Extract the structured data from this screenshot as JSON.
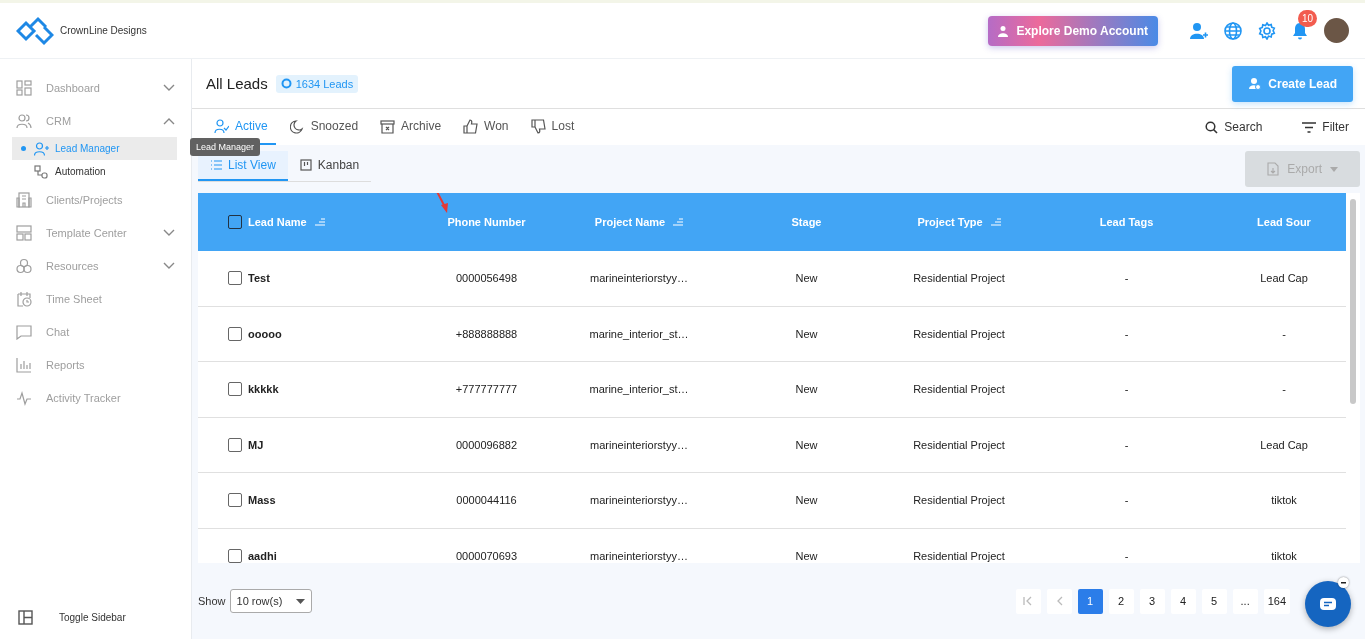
{
  "header": {
    "brand": "CrownLine Designs",
    "demo_button": "Explore Demo Account",
    "notification_count": "10"
  },
  "sidebar": {
    "items": [
      {
        "label": "Dashboard",
        "selected": false,
        "expanded": false
      },
      {
        "label": "CRM",
        "selected": false,
        "expanded": true,
        "children": [
          {
            "label": "Lead Manager",
            "selected": true
          },
          {
            "label": "Automation",
            "selected": false
          }
        ]
      },
      {
        "label": "Clients/Projects",
        "selected": false
      },
      {
        "label": "Template Center",
        "selected": false,
        "expanded": false
      },
      {
        "label": "Resources",
        "selected": false,
        "expanded": false
      },
      {
        "label": "Time Sheet",
        "selected": false
      },
      {
        "label": "Chat",
        "selected": false
      },
      {
        "label": "Reports",
        "selected": false
      },
      {
        "label": "Activity Tracker",
        "selected": false
      }
    ],
    "toggle": "Toggle Sidebar",
    "tooltip": "Lead Manager"
  },
  "page": {
    "title": "All Leads",
    "count_badge": "1634 Leads",
    "create_button": "Create Lead"
  },
  "status_tabs": [
    {
      "label": "Active",
      "selected": true
    },
    {
      "label": "Snoozed",
      "selected": false
    },
    {
      "label": "Archive",
      "selected": false
    },
    {
      "label": "Won",
      "selected": false
    },
    {
      "label": "Lost",
      "selected": false
    }
  ],
  "toolbar": {
    "search": "Search",
    "filter": "Filter"
  },
  "view_tabs": [
    {
      "label": "List View",
      "selected": true
    },
    {
      "label": "Kanban",
      "selected": false
    }
  ],
  "export": {
    "label": "Export",
    "disabled": true
  },
  "table": {
    "all_checked": false,
    "columns": [
      {
        "label": "Lead Name",
        "sortable": true
      },
      {
        "label": "Phone Number",
        "sortable": false
      },
      {
        "label": "Project Name",
        "sortable": true
      },
      {
        "label": "Stage",
        "sortable": false
      },
      {
        "label": "Project Type",
        "sortable": true
      },
      {
        "label": "Lead Tags",
        "sortable": false
      },
      {
        "label": "Lead Sour",
        "sortable": false
      }
    ],
    "rows": [
      {
        "checked": false,
        "cells": [
          "Test",
          "0000056498",
          "marineinteriorstyy…",
          "New",
          "Residential Project",
          "-",
          "Lead Cap"
        ]
      },
      {
        "checked": false,
        "cells": [
          "ooooo",
          "+888888888",
          "marine_interior_st…",
          "New",
          "Residential Project",
          "-",
          "-"
        ]
      },
      {
        "checked": false,
        "cells": [
          "kkkkk",
          "+777777777",
          "marine_interior_st…",
          "New",
          "Residential Project",
          "-",
          "-"
        ]
      },
      {
        "checked": false,
        "cells": [
          "MJ",
          "0000096882",
          "marineinteriorstyy…",
          "New",
          "Residential Project",
          "-",
          "Lead Cap"
        ]
      },
      {
        "checked": false,
        "cells": [
          "Mass",
          "0000044116",
          "marineinteriorstyy…",
          "New",
          "Residential Project",
          "-",
          "tiktok"
        ]
      },
      {
        "checked": false,
        "cells": [
          "aadhi",
          "0000070693",
          "marineinteriorstyy…",
          "New",
          "Residential Project",
          "-",
          "tiktok"
        ]
      }
    ]
  },
  "pagination": {
    "show_label": "Show",
    "rows_value": "10 row(s)",
    "pages": [
      {
        "label": "1",
        "selected": true
      },
      {
        "label": "2",
        "selected": false
      },
      {
        "label": "3",
        "selected": false
      },
      {
        "label": "4",
        "selected": false
      },
      {
        "label": "5",
        "selected": false
      },
      {
        "label": "...",
        "selected": false
      },
      {
        "label": "164",
        "selected": false
      }
    ]
  }
}
